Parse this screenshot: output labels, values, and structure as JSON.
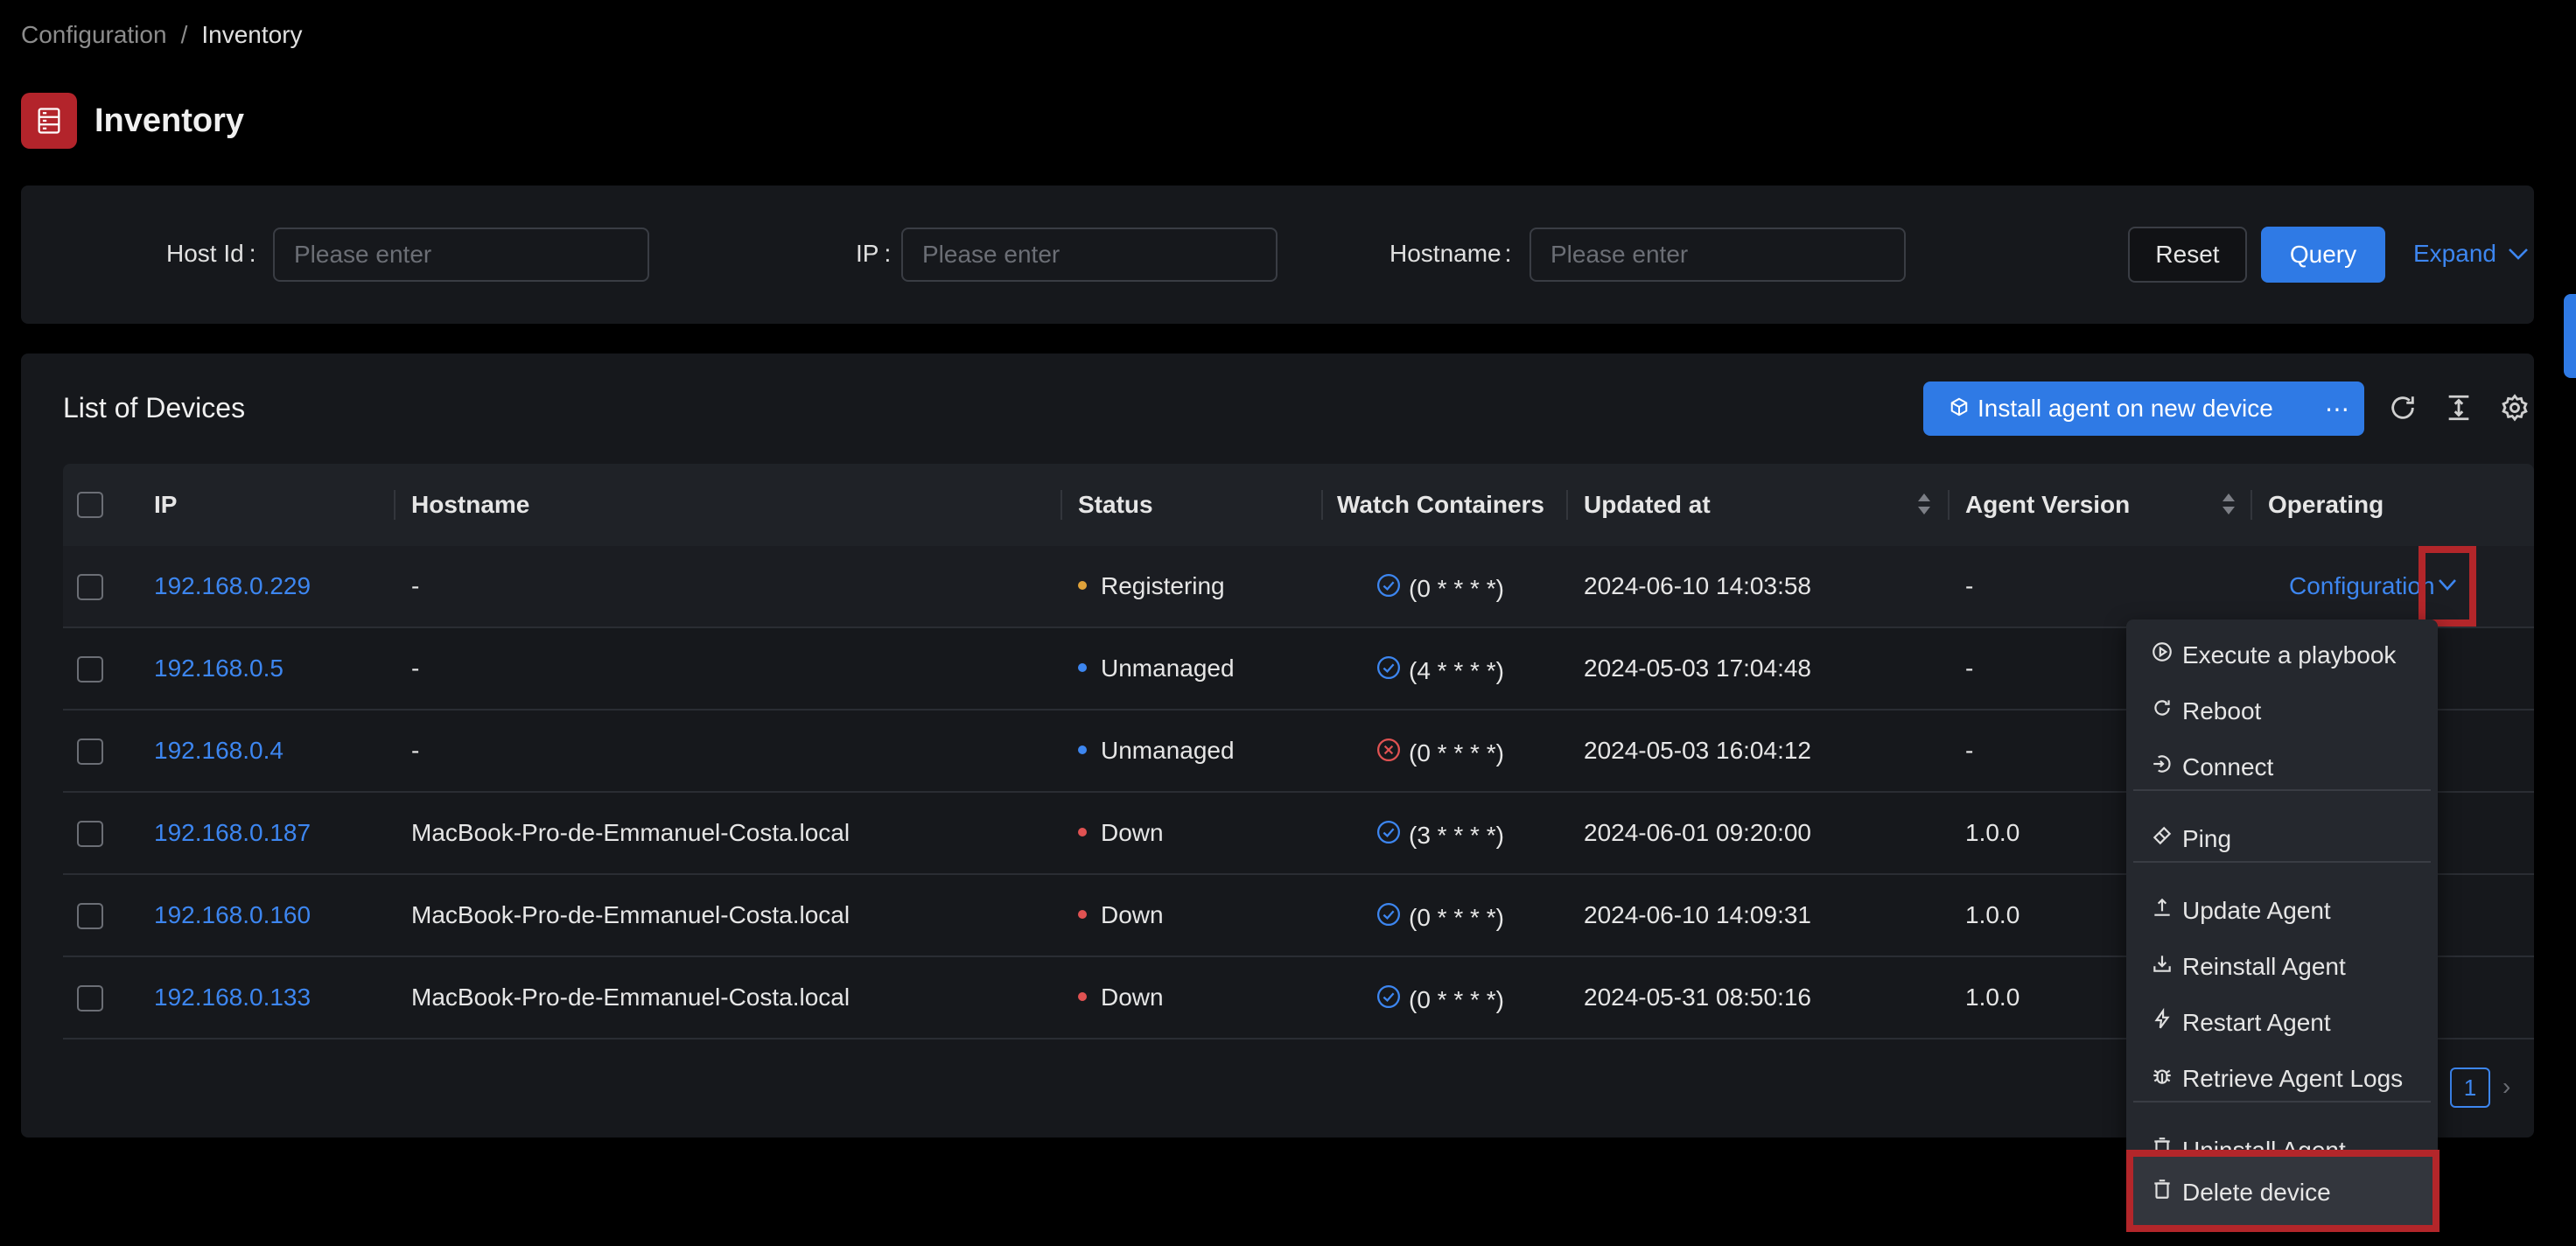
{
  "breadcrumb": {
    "parent": "Configuration",
    "separator": "/",
    "current": "Inventory"
  },
  "page": {
    "title": "Inventory",
    "icon": "server-icon"
  },
  "filters": {
    "host_id_label": "Host Id",
    "ip_label": "IP",
    "hostname_label": "Hostname",
    "placeholder": "Please enter",
    "colon": ":",
    "reset_label": "Reset",
    "query_label": "Query",
    "expand_label": "Expand"
  },
  "list": {
    "title": "List of Devices",
    "install_label": "Install agent on new device",
    "more_label": "⋯",
    "columns": {
      "ip": "IP",
      "hostname": "Hostname",
      "status": "Status",
      "watch": "Watch Containers",
      "updated": "Updated at",
      "agent": "Agent Version",
      "operating": "Operating"
    },
    "rows": [
      {
        "ip": "192.168.0.229",
        "hostname": "-",
        "status": "Registering",
        "status_color": "#e0a23a",
        "watch_ok": true,
        "watch": "(0 * * * *)",
        "updated": "2024-06-10 14:03:58",
        "agent": "-"
      },
      {
        "ip": "192.168.0.5",
        "hostname": "-",
        "status": "Unmanaged",
        "status_color": "#3d86f0",
        "watch_ok": true,
        "watch": "(4 * * * *)",
        "updated": "2024-05-03 17:04:48",
        "agent": "-"
      },
      {
        "ip": "192.168.0.4",
        "hostname": "-",
        "status": "Unmanaged",
        "status_color": "#3d86f0",
        "watch_ok": false,
        "watch": "(0 * * * *)",
        "updated": "2024-05-03 16:04:12",
        "agent": "-"
      },
      {
        "ip": "192.168.0.187",
        "hostname": "MacBook-Pro-de-Emmanuel-Costa.local",
        "status": "Down",
        "status_color": "#e05252",
        "watch_ok": true,
        "watch": "(3 * * * *)",
        "updated": "2024-06-01 09:20:00",
        "agent": "1.0.0"
      },
      {
        "ip": "192.168.0.160",
        "hostname": "MacBook-Pro-de-Emmanuel-Costa.local",
        "status": "Down",
        "status_color": "#e05252",
        "watch_ok": true,
        "watch": "(0 * * * *)",
        "updated": "2024-06-10 14:09:31",
        "agent": "1.0.0"
      },
      {
        "ip": "192.168.0.133",
        "hostname": "MacBook-Pro-de-Emmanuel-Costa.local",
        "status": "Down",
        "status_color": "#e05252",
        "watch_ok": true,
        "watch": "(0 * * * *)",
        "updated": "2024-05-31 08:50:16",
        "agent": "1.0.0"
      }
    ],
    "operating_label": "Configuration",
    "pagination": {
      "current_page": "1",
      "next": "›"
    }
  },
  "menu": {
    "execute": "Execute a playbook",
    "reboot": "Reboot",
    "connect": "Connect",
    "ping": "Ping",
    "update": "Update Agent",
    "reinstall": "Reinstall Agent",
    "restart": "Restart Agent",
    "logs": "Retrieve Agent Logs",
    "uninstall": "Uninstall Agent",
    "delete": "Delete device"
  },
  "colors": {
    "accent": "#2f7ae5",
    "link": "#3d86f0",
    "highlight_box": "#b3262a",
    "brand_icon": "#b3242b"
  }
}
